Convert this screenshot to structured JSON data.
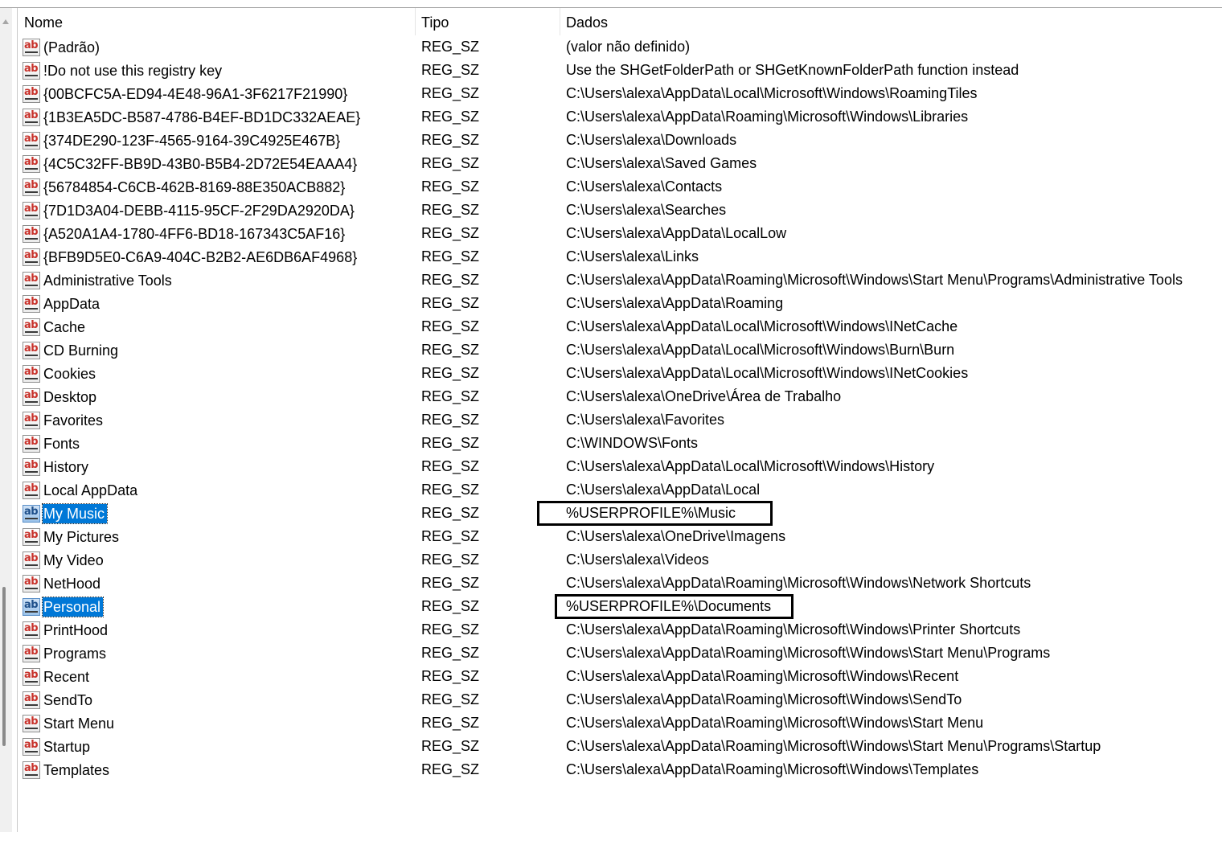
{
  "columns": {
    "name": "Nome",
    "type": "Tipo",
    "data": "Dados"
  },
  "rows": [
    {
      "name": "(Padrão)",
      "type": "REG_SZ",
      "data": "(valor não definido)"
    },
    {
      "name": "!Do not use this registry key",
      "type": "REG_SZ",
      "data": "Use the SHGetFolderPath or SHGetKnownFolderPath function instead"
    },
    {
      "name": "{00BCFC5A-ED94-4E48-96A1-3F6217F21990}",
      "type": "REG_SZ",
      "data": "C:\\Users\\alexa\\AppData\\Local\\Microsoft\\Windows\\RoamingTiles"
    },
    {
      "name": "{1B3EA5DC-B587-4786-B4EF-BD1DC332AEAE}",
      "type": "REG_SZ",
      "data": "C:\\Users\\alexa\\AppData\\Roaming\\Microsoft\\Windows\\Libraries"
    },
    {
      "name": "{374DE290-123F-4565-9164-39C4925E467B}",
      "type": "REG_SZ",
      "data": "C:\\Users\\alexa\\Downloads"
    },
    {
      "name": "{4C5C32FF-BB9D-43B0-B5B4-2D72E54EAAA4}",
      "type": "REG_SZ",
      "data": "C:\\Users\\alexa\\Saved Games"
    },
    {
      "name": "{56784854-C6CB-462B-8169-88E350ACB882}",
      "type": "REG_SZ",
      "data": "C:\\Users\\alexa\\Contacts"
    },
    {
      "name": "{7D1D3A04-DEBB-4115-95CF-2F29DA2920DA}",
      "type": "REG_SZ",
      "data": "C:\\Users\\alexa\\Searches"
    },
    {
      "name": "{A520A1A4-1780-4FF6-BD18-167343C5AF16}",
      "type": "REG_SZ",
      "data": "C:\\Users\\alexa\\AppData\\LocalLow"
    },
    {
      "name": "{BFB9D5E0-C6A9-404C-B2B2-AE6DB6AF4968}",
      "type": "REG_SZ",
      "data": "C:\\Users\\alexa\\Links"
    },
    {
      "name": "Administrative Tools",
      "type": "REG_SZ",
      "data": "C:\\Users\\alexa\\AppData\\Roaming\\Microsoft\\Windows\\Start Menu\\Programs\\Administrative Tools"
    },
    {
      "name": "AppData",
      "type": "REG_SZ",
      "data": "C:\\Users\\alexa\\AppData\\Roaming"
    },
    {
      "name": "Cache",
      "type": "REG_SZ",
      "data": "C:\\Users\\alexa\\AppData\\Local\\Microsoft\\Windows\\INetCache"
    },
    {
      "name": "CD Burning",
      "type": "REG_SZ",
      "data": "C:\\Users\\alexa\\AppData\\Local\\Microsoft\\Windows\\Burn\\Burn"
    },
    {
      "name": "Cookies",
      "type": "REG_SZ",
      "data": "C:\\Users\\alexa\\AppData\\Local\\Microsoft\\Windows\\INetCookies"
    },
    {
      "name": "Desktop",
      "type": "REG_SZ",
      "data": "C:\\Users\\alexa\\OneDrive\\Área de Trabalho"
    },
    {
      "name": "Favorites",
      "type": "REG_SZ",
      "data": "C:\\Users\\alexa\\Favorites"
    },
    {
      "name": "Fonts",
      "type": "REG_SZ",
      "data": "C:\\WINDOWS\\Fonts"
    },
    {
      "name": "History",
      "type": "REG_SZ",
      "data": "C:\\Users\\alexa\\AppData\\Local\\Microsoft\\Windows\\History"
    },
    {
      "name": "Local AppData",
      "type": "REG_SZ",
      "data": "C:\\Users\\alexa\\AppData\\Local"
    },
    {
      "name": "My Music",
      "type": "REG_SZ",
      "data": "%USERPROFILE%\\Music",
      "selected": true,
      "boxed": true
    },
    {
      "name": "My Pictures",
      "type": "REG_SZ",
      "data": "C:\\Users\\alexa\\OneDrive\\Imagens"
    },
    {
      "name": "My Video",
      "type": "REG_SZ",
      "data": "C:\\Users\\alexa\\Videos"
    },
    {
      "name": "NetHood",
      "type": "REG_SZ",
      "data": "C:\\Users\\alexa\\AppData\\Roaming\\Microsoft\\Windows\\Network Shortcuts"
    },
    {
      "name": "Personal",
      "type": "REG_SZ",
      "data": "%USERPROFILE%\\Documents",
      "selected": true,
      "boxed": true
    },
    {
      "name": "PrintHood",
      "type": "REG_SZ",
      "data": "C:\\Users\\alexa\\AppData\\Roaming\\Microsoft\\Windows\\Printer Shortcuts"
    },
    {
      "name": "Programs",
      "type": "REG_SZ",
      "data": "C:\\Users\\alexa\\AppData\\Roaming\\Microsoft\\Windows\\Start Menu\\Programs"
    },
    {
      "name": "Recent",
      "type": "REG_SZ",
      "data": "C:\\Users\\alexa\\AppData\\Roaming\\Microsoft\\Windows\\Recent"
    },
    {
      "name": "SendTo",
      "type": "REG_SZ",
      "data": "C:\\Users\\alexa\\AppData\\Roaming\\Microsoft\\Windows\\SendTo"
    },
    {
      "name": "Start Menu",
      "type": "REG_SZ",
      "data": "C:\\Users\\alexa\\AppData\\Roaming\\Microsoft\\Windows\\Start Menu"
    },
    {
      "name": "Startup",
      "type": "REG_SZ",
      "data": "C:\\Users\\alexa\\AppData\\Roaming\\Microsoft\\Windows\\Start Menu\\Programs\\Startup"
    },
    {
      "name": "Templates",
      "type": "REG_SZ",
      "data": "C:\\Users\\alexa\\AppData\\Roaming\\Microsoft\\Windows\\Templates"
    }
  ],
  "icon_label": "ab",
  "icon_name": "string-value-icon",
  "colors": {
    "selection": "#0078d7",
    "highlight_box": "#000000",
    "icon_text": "#c8312a"
  }
}
